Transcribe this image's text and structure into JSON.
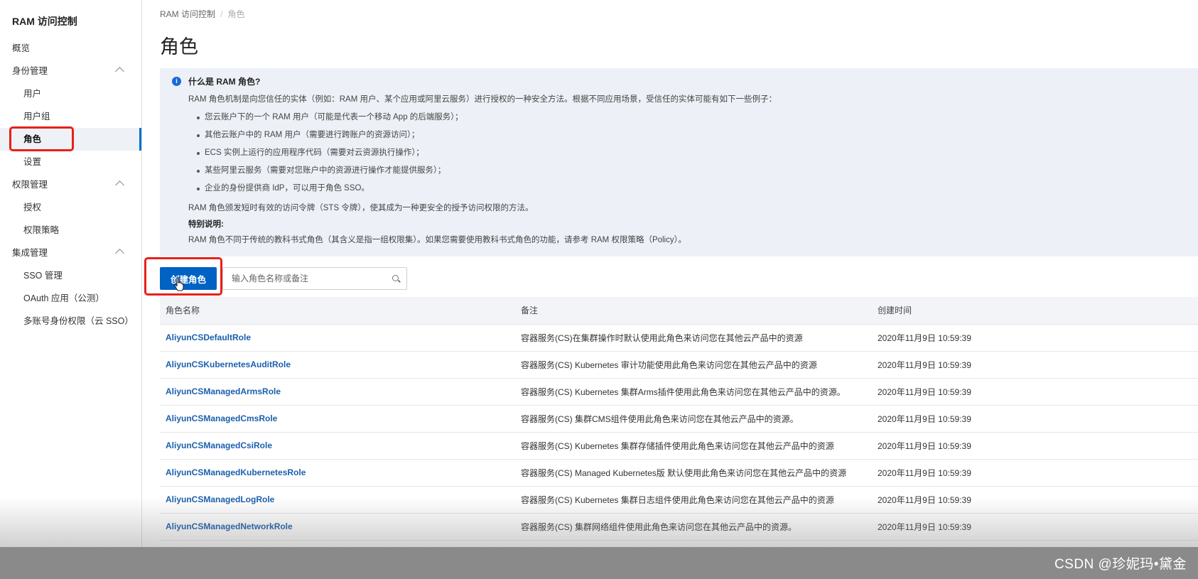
{
  "sidebar": {
    "title": "RAM 访问控制",
    "items": [
      {
        "label": "概览"
      },
      {
        "label": "身份管理"
      },
      {
        "label": "用户"
      },
      {
        "label": "用户组"
      },
      {
        "label": "角色"
      },
      {
        "label": "设置"
      },
      {
        "label": "权限管理"
      },
      {
        "label": "授权"
      },
      {
        "label": "权限策略"
      },
      {
        "label": "集成管理"
      },
      {
        "label": "SSO 管理"
      },
      {
        "label": "OAuth 应用（公测）"
      },
      {
        "label": "多账号身份权限（云 SSO）"
      }
    ]
  },
  "breadcrumb": {
    "root": "RAM 访问控制",
    "separator": "/",
    "current": "角色"
  },
  "page_title": "角色",
  "info": {
    "icon": "info-icon",
    "title": "什么是 RAM 角色?",
    "intro": "RAM 角色机制是向您信任的实体（例如：RAM 用户、某个应用或阿里云服务）进行授权的一种安全方法。根据不同应用场景，受信任的实体可能有如下一些例子：",
    "bullets": [
      "您云账户下的一个 RAM 用户（可能是代表一个移动 App 的后端服务）；",
      "其他云账户中的 RAM 用户（需要进行跨账户的资源访问）；",
      "ECS 实例上运行的应用程序代码（需要对云资源执行操作）；",
      "某些阿里云服务（需要对您账户中的资源进行操作才能提供服务）；",
      "企业的身份提供商 IdP，可以用于角色 SSO。"
    ],
    "sts": "RAM 角色颁发短时有效的访问令牌（STS 令牌），使其成为一种更安全的授予访问权限的方法。",
    "note_title": "特别说明:",
    "note": "RAM 角色不同于传统的教科书式角色（其含义是指一组权限集）。如果您需要使用教科书式角色的功能，请参考 RAM 权限策略（Policy）。"
  },
  "toolbar": {
    "create_label": "创建角色",
    "search_placeholder": "输入角色名称或备注"
  },
  "table": {
    "headers": [
      "角色名称",
      "备注",
      "创建时间"
    ],
    "rows": [
      {
        "name": "AliyunCSDefaultRole",
        "note": "容器服务(CS)在集群操作时默认使用此角色来访问您在其他云产品中的资源",
        "time": "2020年11月9日 10:59:39"
      },
      {
        "name": "AliyunCSKubernetesAuditRole",
        "note": "容器服务(CS) Kubernetes 审计功能使用此角色来访问您在其他云产品中的资源",
        "time": "2020年11月9日 10:59:39"
      },
      {
        "name": "AliyunCSManagedArmsRole",
        "note": "容器服务(CS) Kubernetes 集群Arms插件使用此角色来访问您在其他云产品中的资源。",
        "time": "2020年11月9日 10:59:39"
      },
      {
        "name": "AliyunCSManagedCmsRole",
        "note": "容器服务(CS) 集群CMS组件使用此角色来访问您在其他云产品中的资源。",
        "time": "2020年11月9日 10:59:39"
      },
      {
        "name": "AliyunCSManagedCsiRole",
        "note": "容器服务(CS) Kubernetes 集群存储插件使用此角色来访问您在其他云产品中的资源",
        "time": "2020年11月9日 10:59:39"
      },
      {
        "name": "AliyunCSManagedKubernetesRole",
        "note": "容器服务(CS) Managed Kubernetes版 默认使用此角色来访问您在其他云产品中的资源",
        "time": "2020年11月9日 10:59:39"
      },
      {
        "name": "AliyunCSManagedLogRole",
        "note": "容器服务(CS) Kubernetes 集群日志组件使用此角色来访问您在其他云产品中的资源",
        "time": "2020年11月9日 10:59:39"
      },
      {
        "name": "AliyunCSManagedNetworkRole",
        "note": "容器服务(CS) 集群网络组件使用此角色来访问您在其他云产品中的资源。",
        "time": "2020年11月9日 10:59:39"
      }
    ]
  },
  "watermark": "CSDN @珍妮玛•黛金",
  "colors": {
    "primary": "#0062c3",
    "link": "#1b5fad",
    "highlight": "#e8201a",
    "info_bg": "#edf1f7"
  }
}
